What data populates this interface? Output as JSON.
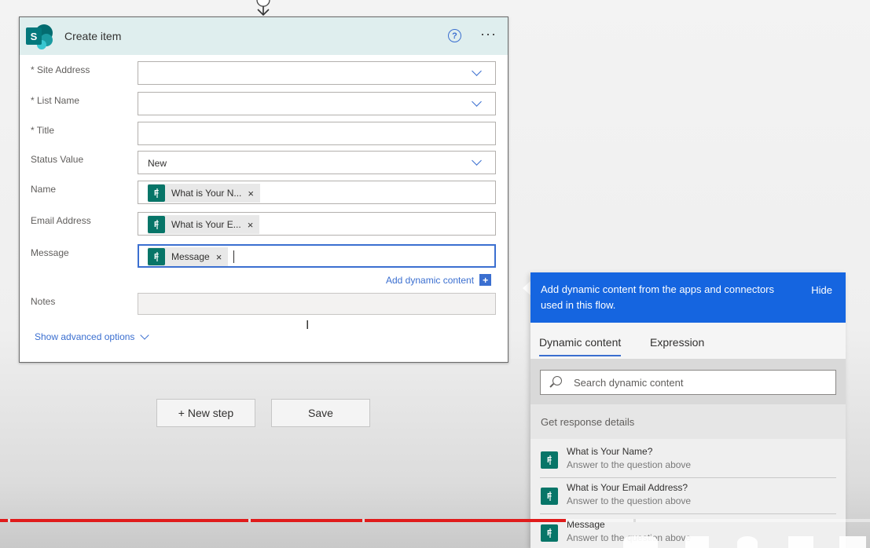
{
  "card": {
    "title": "Create item",
    "logo_letter": "S",
    "help_glyph": "?",
    "more_glyph": "···"
  },
  "fields": {
    "site_address": {
      "label": "* Site Address",
      "value": ""
    },
    "list_name": {
      "label": "* List Name",
      "value": ""
    },
    "title": {
      "label": "* Title",
      "value": ""
    },
    "status_value": {
      "label": "Status Value",
      "value": "New"
    },
    "name": {
      "label": "Name",
      "token": "What is Your N...",
      "token_remove": "×"
    },
    "email_address": {
      "label": "Email Address",
      "token": "What is Your E...",
      "token_remove": "×"
    },
    "message": {
      "label": "Message",
      "token": "Message",
      "token_remove": "×"
    },
    "notes": {
      "label": "Notes",
      "value": ""
    }
  },
  "add_dynamic_content": {
    "label": "Add dynamic content",
    "plus": "+"
  },
  "show_advanced": {
    "label": "Show advanced options"
  },
  "buttons": {
    "new_step": "+ New step",
    "save": "Save"
  },
  "dynamic_panel": {
    "message": "Add dynamic content from the apps and connectors used in this flow.",
    "hide_label": "Hide",
    "tabs": [
      {
        "label": "Dynamic content",
        "selected": true
      },
      {
        "label": "Expression",
        "selected": false
      }
    ],
    "search_placeholder": "Search dynamic content",
    "section_header": "Get response details",
    "items": [
      {
        "title": "What is Your Name?",
        "subtitle": "Answer to the question above"
      },
      {
        "title": "What is Your Email Address?",
        "subtitle": "Answer to the question above"
      },
      {
        "title": "Message",
        "subtitle": "Answer to the question above"
      }
    ]
  },
  "colors": {
    "accent": "#3b6fd0",
    "panel_header": "#1565e0",
    "card_header": "#dfeeee",
    "sharepoint": "#03787c",
    "forms": "#077568",
    "progress": "#e01b1b"
  },
  "video_progress_fraction": 0.65
}
